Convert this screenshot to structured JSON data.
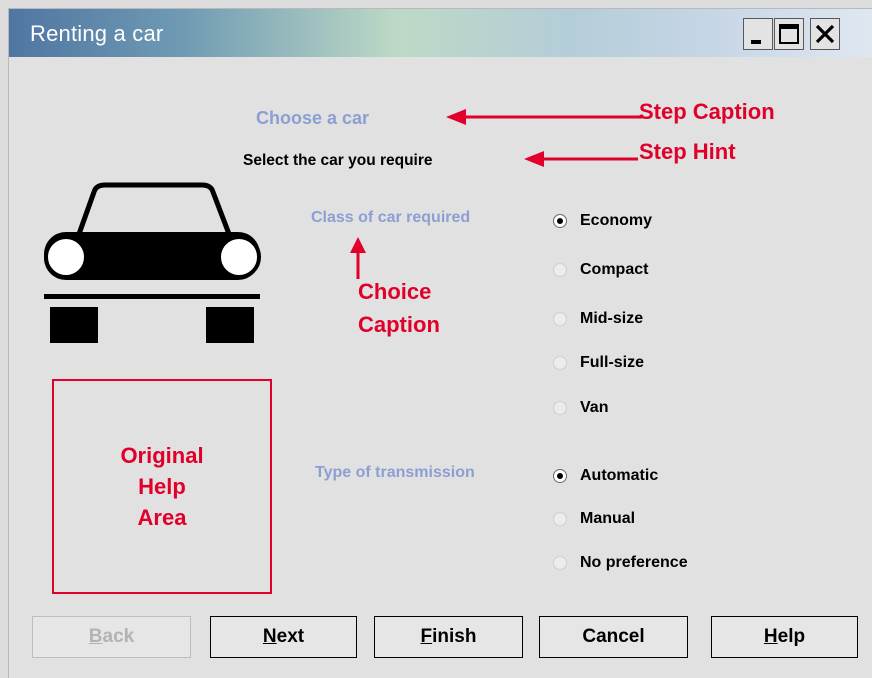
{
  "window": {
    "title": "Renting a car"
  },
  "title_buttons": [
    "minimize",
    "maximize",
    "close"
  ],
  "wizard": {
    "step_caption": "Choose a car",
    "step_hint": "Select the car you require"
  },
  "annotations": {
    "step_caption": "Step Caption",
    "step_hint": "Step Hint",
    "choice_caption": "Choice\nCaption",
    "help_area": "Original\nHelp\nArea"
  },
  "choices": [
    {
      "caption": "Class of car required",
      "options": [
        {
          "label": "Economy",
          "selected": true
        },
        {
          "label": "Compact",
          "selected": false
        },
        {
          "label": "Mid-size",
          "selected": false
        },
        {
          "label": "Full-size",
          "selected": false
        },
        {
          "label": "Van",
          "selected": false
        }
      ]
    },
    {
      "caption": "Type of transmission",
      "options": [
        {
          "label": "Automatic",
          "selected": true
        },
        {
          "label": "Manual",
          "selected": false
        },
        {
          "label": "No preference",
          "selected": false
        }
      ]
    }
  ],
  "buttons": {
    "back": {
      "mnemonic": "B",
      "rest": "ack",
      "enabled": false
    },
    "next": {
      "mnemonic": "N",
      "rest": "ext",
      "enabled": true
    },
    "finish": {
      "mnemonic": "F",
      "rest": "inish",
      "enabled": true
    },
    "cancel": {
      "label": "Cancel",
      "enabled": true
    },
    "help": {
      "mnemonic": "H",
      "rest": "elp",
      "enabled": true
    }
  },
  "colors": {
    "caption": "#8c9fd2",
    "annotation": "#e0002a",
    "text": "#000000"
  },
  "icons": [
    "car-icon",
    "arrow-left-icon",
    "arrow-up-icon"
  ]
}
